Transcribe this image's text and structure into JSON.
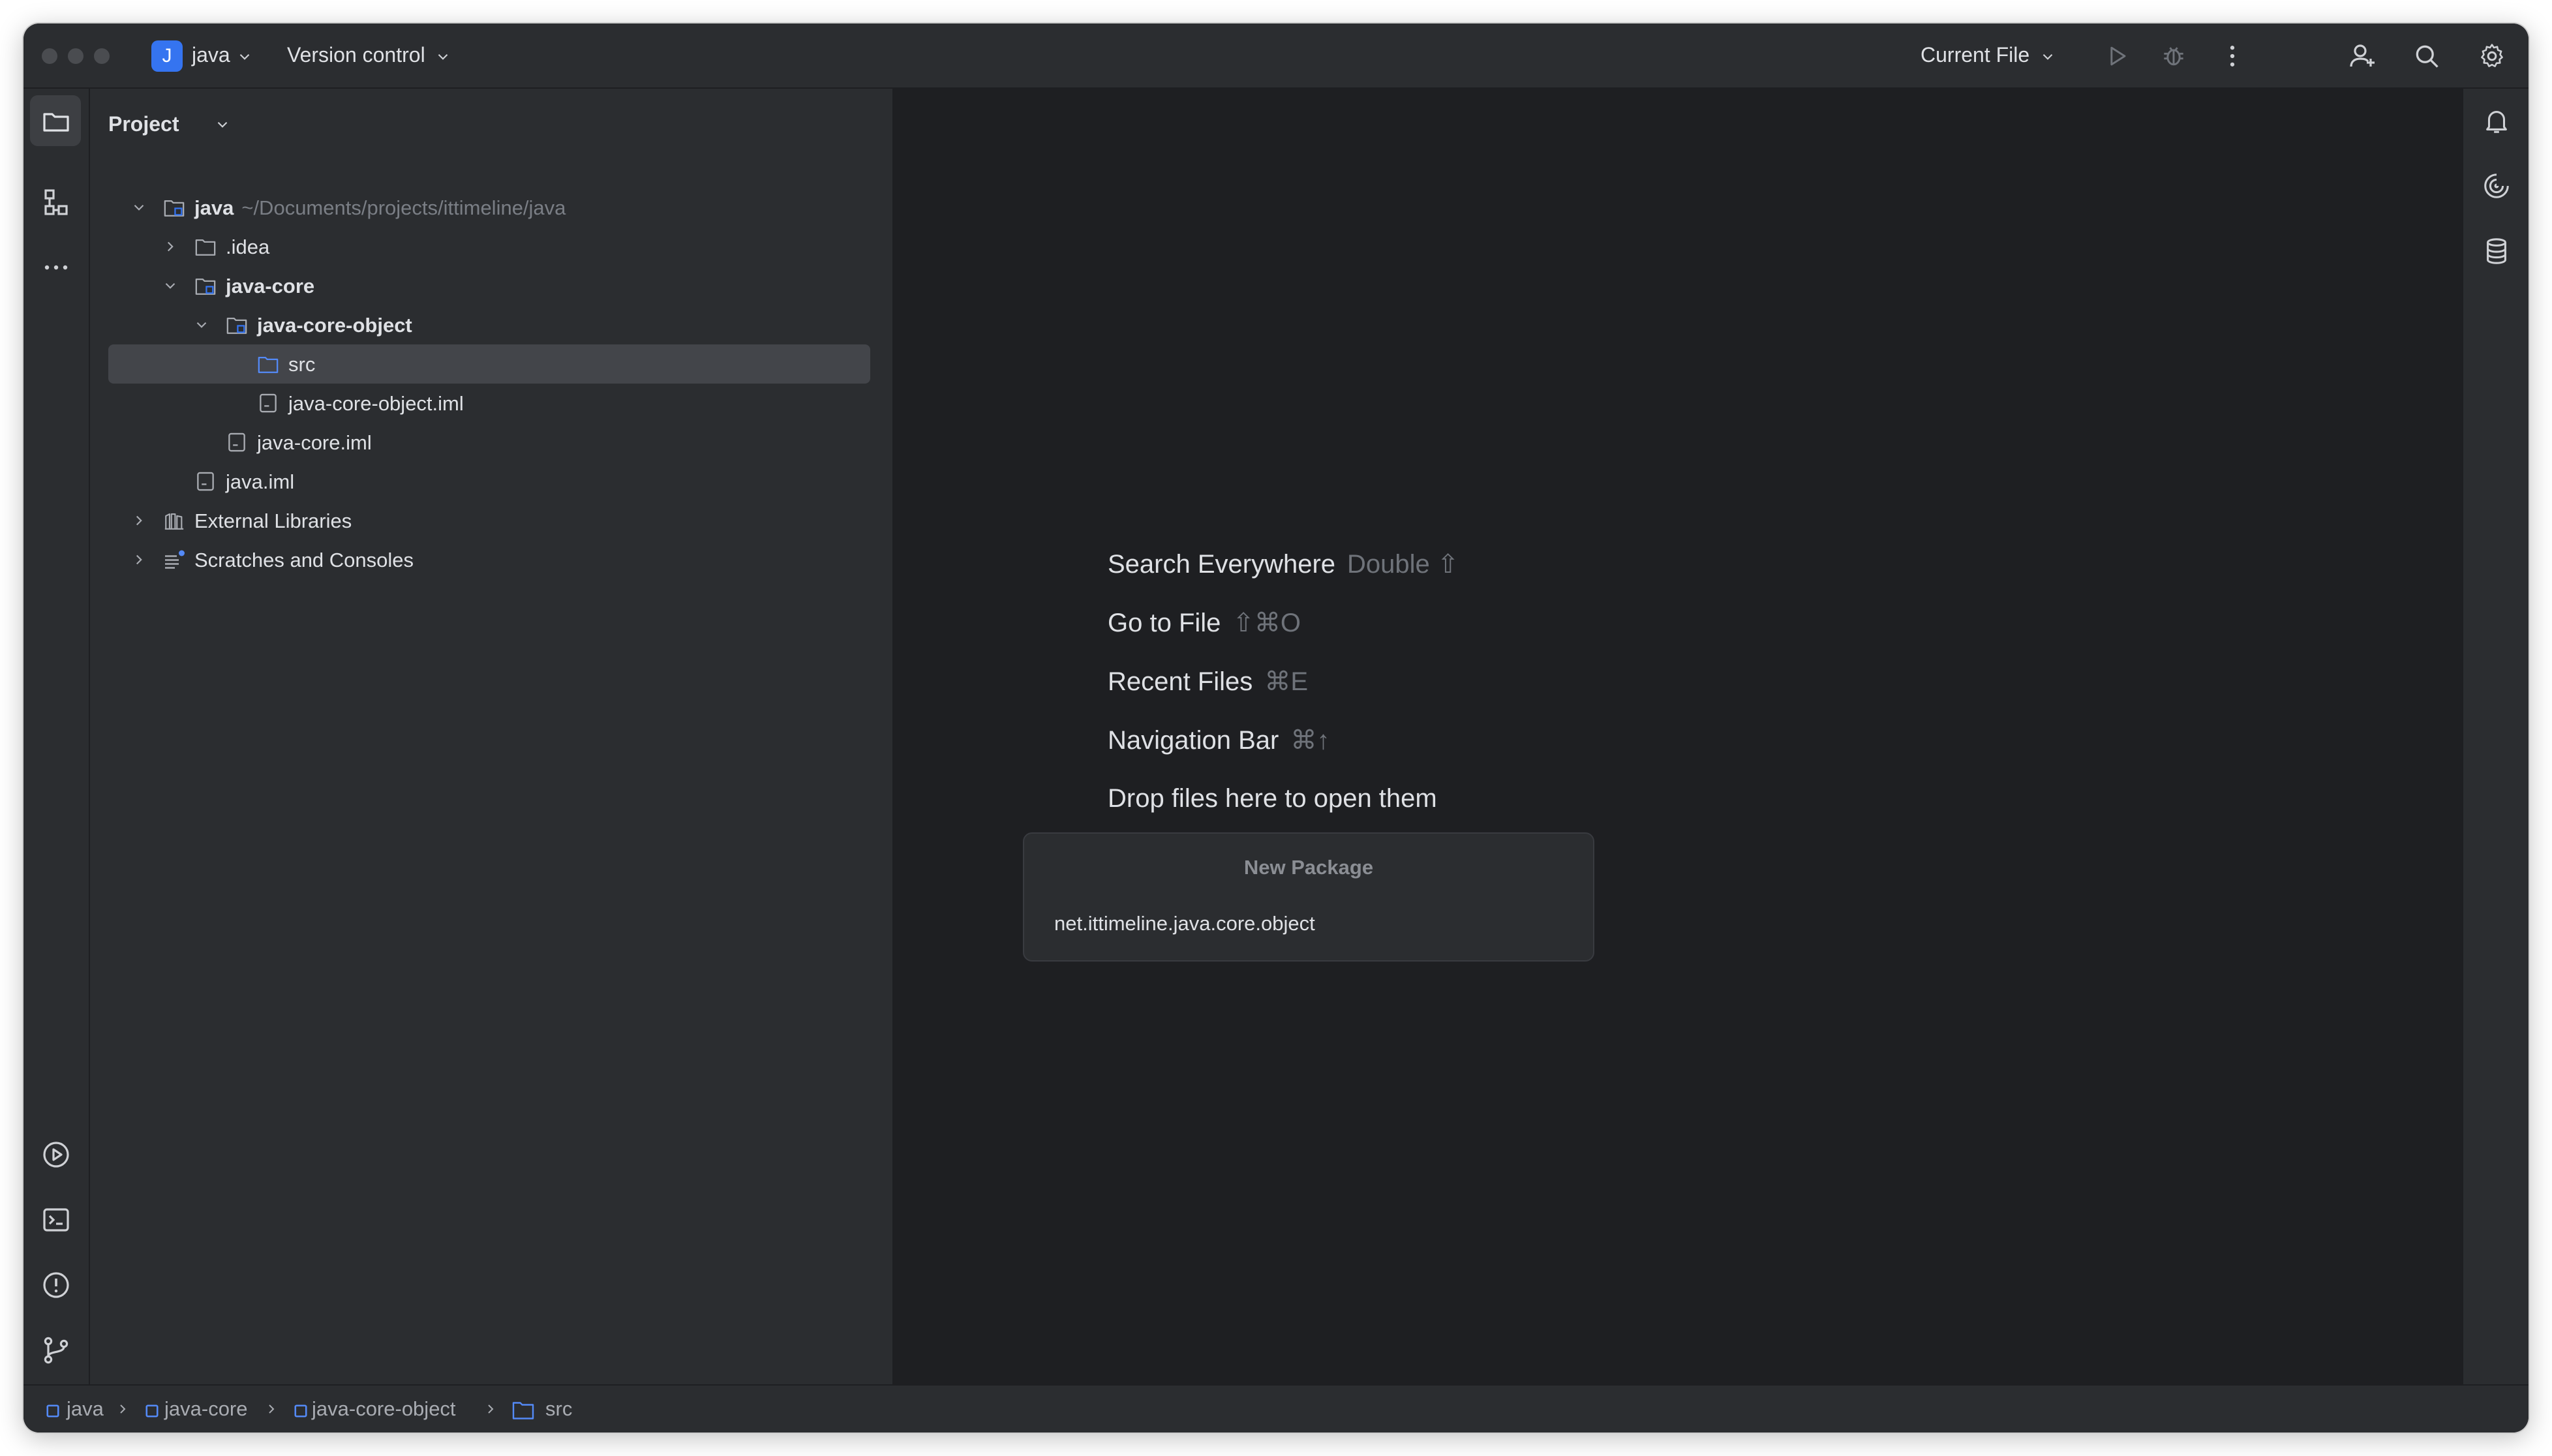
{
  "titlebar": {
    "project_initial": "J",
    "project_name": "java",
    "version_control": "Version control",
    "run_config": "Current File"
  },
  "project_panel": {
    "title": "Project",
    "tree": [
      {
        "label": "java",
        "path": "~/Documents/projects/ittimeline/java",
        "bold": true,
        "expanded": true,
        "icon": "module-folder-icon"
      },
      {
        "label": ".idea",
        "expanded": false,
        "icon": "folder-icon"
      },
      {
        "label": "java-core",
        "bold": true,
        "expanded": true,
        "icon": "module-folder-icon"
      },
      {
        "label": "java-core-object",
        "bold": true,
        "expanded": true,
        "icon": "module-folder-icon"
      },
      {
        "label": "src",
        "selected": true,
        "icon": "source-folder-icon"
      },
      {
        "label": "java-core-object.iml",
        "icon": "iml-file-icon"
      },
      {
        "label": "java-core.iml",
        "icon": "iml-file-icon"
      },
      {
        "label": "java.iml",
        "icon": "iml-file-icon"
      },
      {
        "label": "External Libraries",
        "expanded": false,
        "icon": "library-icon"
      },
      {
        "label": "Scratches and Consoles",
        "expanded": false,
        "icon": "scratches-icon"
      }
    ]
  },
  "editor": {
    "hints": [
      {
        "label": "Search Everywhere",
        "shortcut": "Double ⇧"
      },
      {
        "label": "Go to File",
        "shortcut": "⇧⌘O"
      },
      {
        "label": "Recent Files",
        "shortcut": "⌘E"
      },
      {
        "label": "Navigation Bar",
        "shortcut": "⌘↑"
      },
      {
        "label": "Drop files here to open them",
        "shortcut": ""
      }
    ],
    "new_package_popup": {
      "title": "New Package",
      "value": "net.ittimeline.java.core.object"
    }
  },
  "statusbar": {
    "breadcrumbs": [
      "java",
      "java-core",
      "java-core-object",
      "src"
    ]
  },
  "colors": {
    "background": "#1e1f22",
    "panel": "#2b2d30",
    "accent": "#3574f0",
    "text": "#dfe1e5",
    "muted": "#7a7e85",
    "selection": "#43454a"
  }
}
